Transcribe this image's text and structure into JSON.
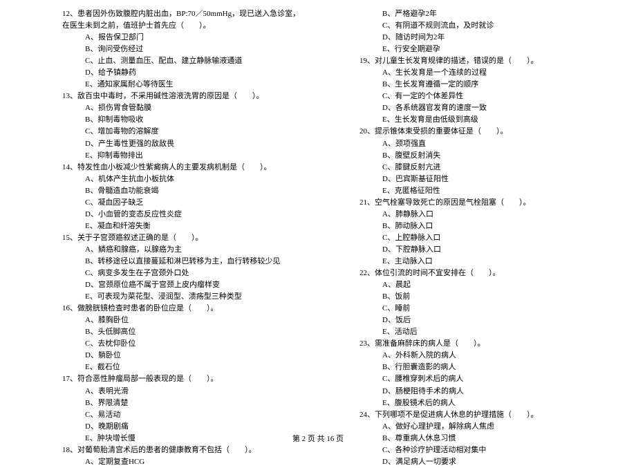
{
  "footer": "第 2 页 共 16 页",
  "left": [
    {
      "stem": "12、患者因外伤致腹腔内脏出血，BP:70／50mmHg，现已送入急诊室，在医生未到之前，值班护士首先应（　　）。",
      "opts": [
        "A、报告保卫部门",
        "B、询问受伤经过",
        "C、止血、测量血压、配血、建立静脉输液通道",
        "D、给予镇静药",
        "E、通知家属耐心等待医生"
      ]
    },
    {
      "stem": "13、敌百虫中毒时，不采用碱性溶液洗胃的原因是（　　）。",
      "opts": [
        "A、损伤胃食管黏膜",
        "B、抑制毒物吸收",
        "C、增加毒物的溶解度",
        "D、产生毒性更强的敌敌畏",
        "E、抑制毒物排出"
      ]
    },
    {
      "stem": "14、特发性血小板减少性紫癜病人的主要发病机制是（　　）。",
      "opts": [
        "A、机体产生抗血小板抗体",
        "B、骨髓造血功能衰竭",
        "C、凝血因子缺乏",
        "D、小血管的变态反应性炎症",
        "E、凝血和纤溶失衡"
      ]
    },
    {
      "stem": "15、关于子宫颈癌叙述正确的是（　　）。",
      "opts": [
        "A、鳞癌和腺癌，以腺癌为主",
        "B、转移途径以直接蔓延和淋巴转移为主，血行转移较少见",
        "C、病变多发生在子宫颈外口处",
        "D、宫颈原位癌不属于宫颈上皮内瘤样变",
        "E、可表现为菜花型、浸润型、溃疡型三种类型"
      ]
    },
    {
      "stem": "16、做膀胱镜检查时患者的卧位应是（　　）。",
      "opts": [
        "A、膝胸卧位",
        "B、头低脚高位",
        "C、去枕仰卧位",
        "D、躺卧位",
        "E、截石位"
      ]
    },
    {
      "stem": "17、符合恶性肿瘤局部一般表现的是（　　）。",
      "opts": [
        "A、表明光滑",
        "B、界限清楚",
        "C、易活动",
        "D、晚期剧痛",
        "E、肿块增长慢"
      ]
    },
    {
      "stem": "18、对葡萄胎清宫术后的患者的健康教育不包括（　　）。",
      "opts": [
        "A、定期复查HCG"
      ]
    }
  ],
  "right": [
    {
      "stem": "",
      "opts": [
        "B、严格避孕2年",
        "C、有阴道不规则流血，及时就诊",
        "D、随访时间为2年",
        "E、行安全期避孕"
      ]
    },
    {
      "stem": "19、对儿童生长发育规律的描述，错误的是（　　）。",
      "opts": [
        "A、生长发育是一个连续的过程",
        "B、生长发育遵循一定的顺序",
        "C、有一定的个体差异性",
        "D、各系统器官发育的速度一致",
        "E、生长发育是由低级到高级"
      ]
    },
    {
      "stem": "20、提示锥体束受损的重要体征是（　　）。",
      "opts": [
        "A、颈项强直",
        "B、腹壁反射消失",
        "C、膝腱反射亢进",
        "D、巴宾斯基征阳性",
        "E、克匿格征阳性"
      ]
    },
    {
      "stem": "21、空气栓塞导致死亡的原因是气栓阻塞（　　）。",
      "opts": [
        "A、肺静脉入口",
        "B、肺动脉入口",
        "C、上腔静脉入口",
        "D、下腔静脉入口",
        "E、主动脉入口"
      ]
    },
    {
      "stem": "22、体位引流的时间不宜安排在（　　）。",
      "opts": [
        "A、晨起",
        "B、饭前",
        "C、睡前",
        "D、饭后",
        "E、活动后"
      ]
    },
    {
      "stem": "23、需准备麻醉床的病人是（　　）。",
      "opts": [
        "A、外科新入院的病人",
        "B、行胆囊造影的病人",
        "C、腰椎穿刺术后的病人",
        "D、肠梗阻待手术的病人",
        "E、腹股镜术后的病人"
      ]
    },
    {
      "stem": "24、下列哪项不是促进病人休息的护理措施（　　）。",
      "opts": [
        "A、做好心理护理，解除病人焦虑",
        "B、尊重病人休息习惯",
        "C、各种诊疗护理活动相对集中",
        "D、满足病人一切要求"
      ]
    }
  ]
}
